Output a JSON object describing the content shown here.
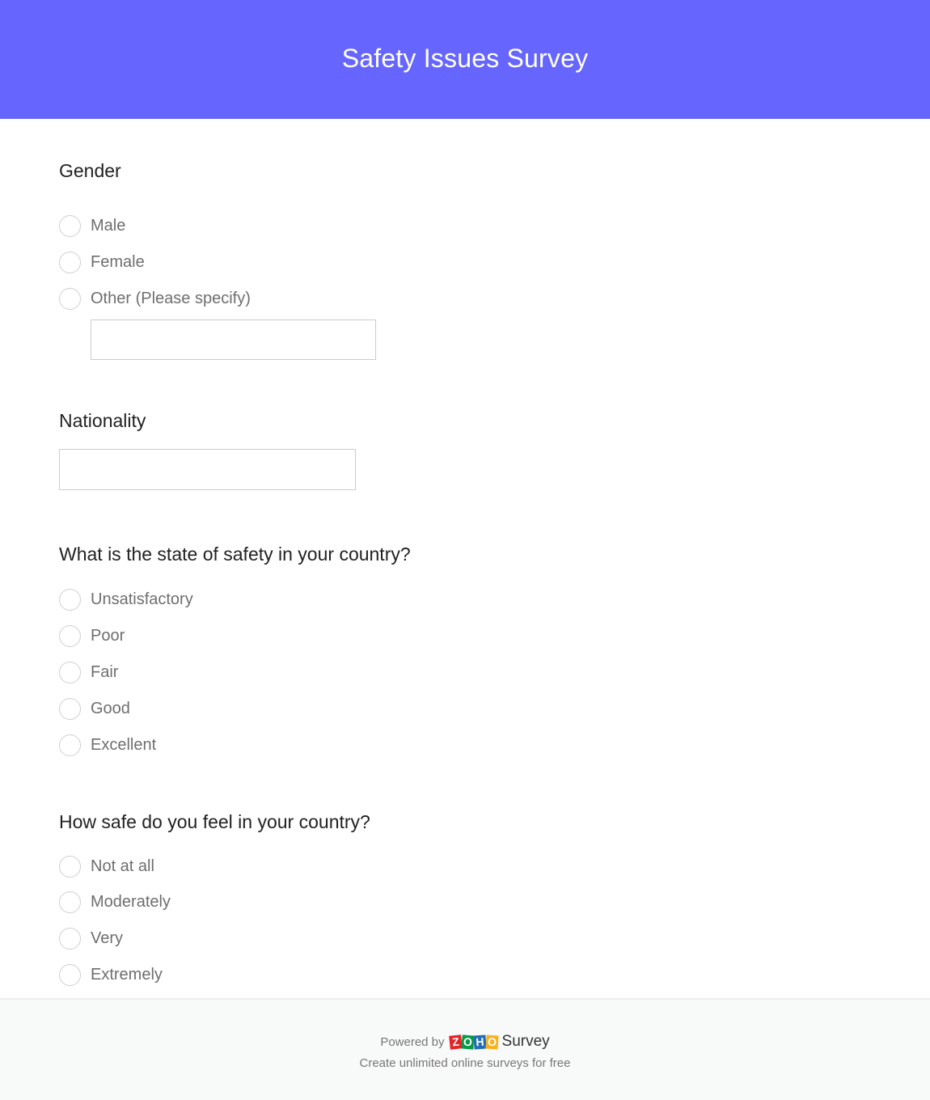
{
  "header": {
    "title": "Safety Issues Survey",
    "background_color": "#6666ff"
  },
  "questions": [
    {
      "title": "Gender",
      "type": "radio",
      "options": [
        "Male",
        "Female",
        "Other (Please specify)"
      ],
      "other_input": {
        "value": "",
        "placeholder": ""
      }
    },
    {
      "title": "Nationality",
      "type": "text",
      "input": {
        "value": "",
        "placeholder": ""
      }
    },
    {
      "title": "What is the state of safety in your country?",
      "type": "radio",
      "options": [
        "Unsatisfactory",
        "Poor",
        "Fair",
        "Good",
        "Excellent"
      ]
    },
    {
      "title": "How safe do you feel in your country?",
      "type": "radio",
      "options": [
        "Not at all",
        "Moderately",
        "Very",
        "Extremely"
      ]
    }
  ],
  "footer": {
    "powered_by": "Powered by",
    "logo_letters": [
      "Z",
      "O",
      "H",
      "O"
    ],
    "logo_colors": [
      "#e42527",
      "#089949",
      "#226db4",
      "#f9b21d"
    ],
    "brand": "Survey",
    "tagline": "Create unlimited online surveys for free"
  }
}
